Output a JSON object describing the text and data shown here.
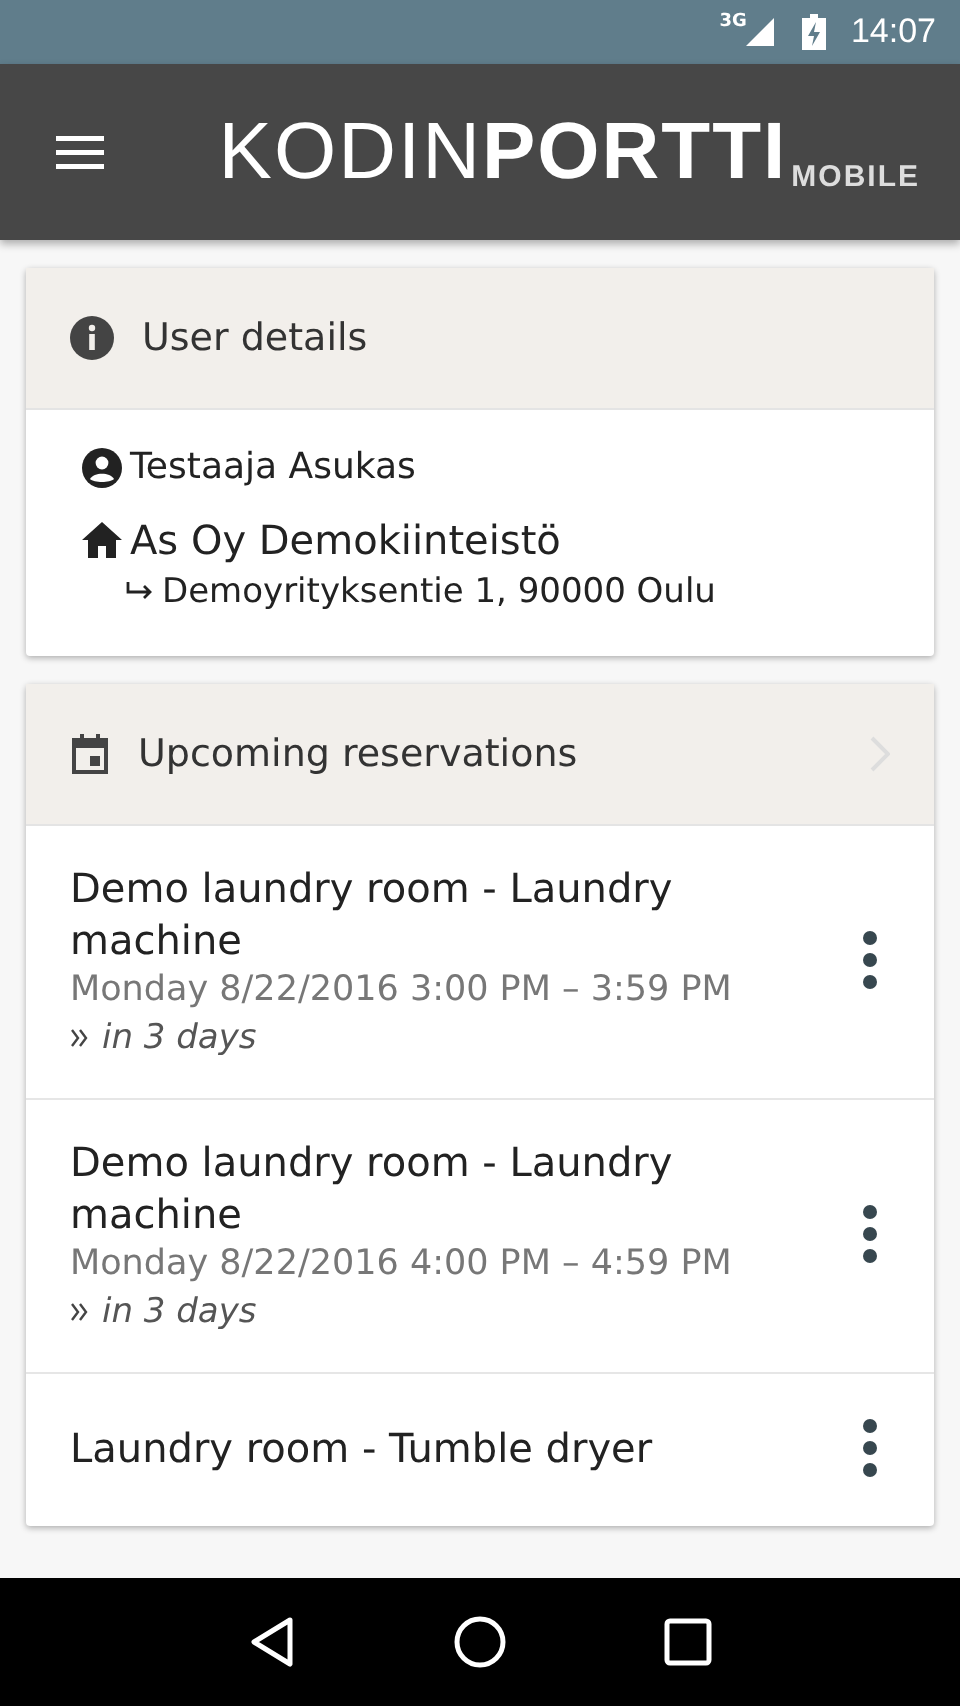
{
  "status_bar": {
    "network": "3G",
    "time": "14:07"
  },
  "app_bar": {
    "logo": {
      "light": "KODIN",
      "bold": "PORTTI",
      "sub": "MOBILE"
    }
  },
  "user_card": {
    "title": "User details",
    "name": "Testaaja Asukas",
    "property": "As Oy Demokiinteistö",
    "address": "Demoyrityksentie 1, 90000 Oulu"
  },
  "reservations_card": {
    "title": "Upcoming reservations",
    "items": [
      {
        "title": "Demo laundry room - Laundry machine",
        "time": "Monday 8/22/2016 3:00 PM – 3:59 PM",
        "relative": "in 3 days"
      },
      {
        "title": "Demo laundry room - Laundry machine",
        "time": "Monday 8/22/2016 4:00 PM – 4:59 PM",
        "relative": "in 3 days"
      },
      {
        "title": "Laundry room - Tumble dryer"
      }
    ]
  }
}
